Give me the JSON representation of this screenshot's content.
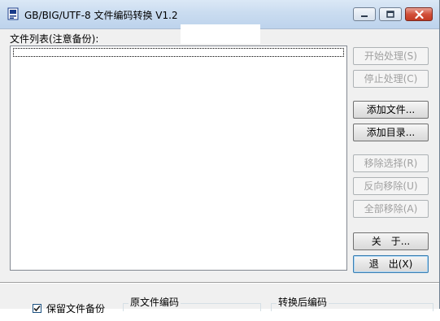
{
  "window": {
    "title": "GB/BIG/UTF-8 文件编码转换 V1.2"
  },
  "file_list": {
    "label": "文件列表(注意备份):"
  },
  "buttons": {
    "start": "开始处理(S)",
    "stop": "停止处理(C)",
    "add_file": "添加文件...",
    "add_dir": "添加目录...",
    "remove_selected": "移除选择(R)",
    "remove_inverse": "反向移除(U)",
    "remove_all": "全部移除(A)",
    "about": "关　于...",
    "exit": "退　出(X)"
  },
  "options": {
    "keep_backup": "保留文件备份",
    "keep_backup_checked": true
  },
  "groups": {
    "source_encoding": "原文件编码",
    "target_encoding": "转换后编码"
  },
  "colors": {
    "titlebar": "#cadcf0",
    "close_button": "#c23a22",
    "disabled_text": "#a0a0a0",
    "default_button_border": "#3c7fb1"
  }
}
